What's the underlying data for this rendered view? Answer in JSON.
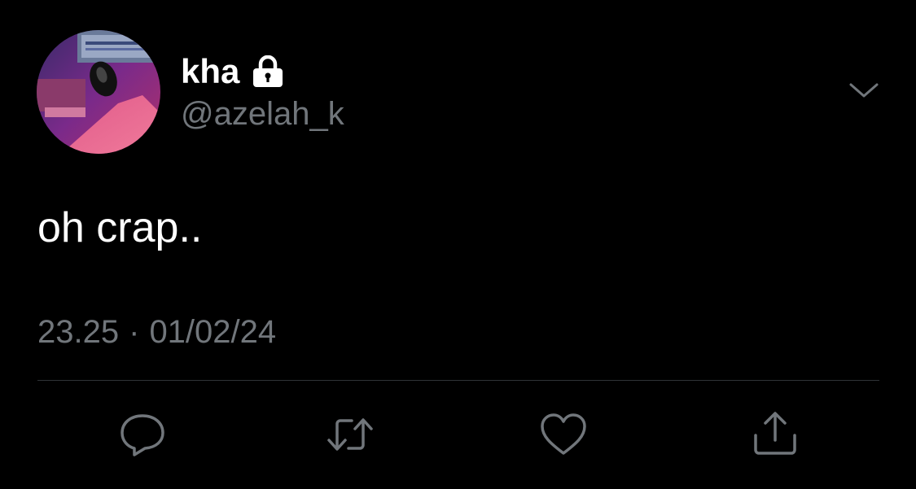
{
  "tweet": {
    "author": {
      "display_name": "kha",
      "handle": "@azelah_k",
      "protected_icon": "lock-icon",
      "avatar_icon": "avatar-photo"
    },
    "text": "oh crap..",
    "time": "23.25",
    "separator": "·",
    "date": "01/02/24",
    "menu_icon": "chevron-down-icon"
  },
  "actions": [
    {
      "name": "reply",
      "icon": "reply-icon"
    },
    {
      "name": "retweet",
      "icon": "retweet-icon"
    },
    {
      "name": "like",
      "icon": "heart-icon"
    },
    {
      "name": "share",
      "icon": "share-icon"
    }
  ],
  "colors": {
    "background": "#000000",
    "primary_text": "#ffffff",
    "secondary_text": "#71767b",
    "divider": "#2f3336",
    "icon": "#71767b"
  }
}
